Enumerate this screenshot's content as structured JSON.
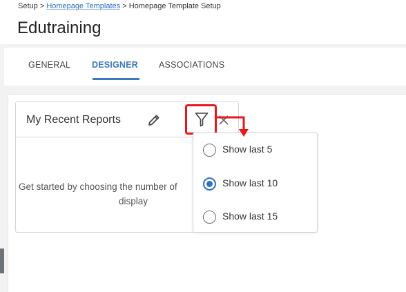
{
  "breadcrumb": {
    "root": "Setup",
    "sep": ">",
    "middle": "Homepage Templates",
    "current": "Homepage Template Setup"
  },
  "page": {
    "title": "Edutraining"
  },
  "tabs": [
    {
      "label": "GENERAL",
      "active": false
    },
    {
      "label": "DESIGNER",
      "active": true
    },
    {
      "label": "ASSOCIATIONS",
      "active": false
    }
  ],
  "widget": {
    "title": "My Recent Reports",
    "empty_line1": "Get started by choosing the number of",
    "empty_line2": "display"
  },
  "filter_menu": {
    "options": [
      {
        "label": "Show last 5",
        "checked": false
      },
      {
        "label": "Show last 10",
        "checked": true
      },
      {
        "label": "Show last 15",
        "checked": false
      }
    ]
  },
  "colors": {
    "accent": "#3a78c2",
    "annotation": "#e8161b"
  },
  "icons": [
    "pencil-icon",
    "filter-icon",
    "close-icon",
    "radio-icon"
  ]
}
